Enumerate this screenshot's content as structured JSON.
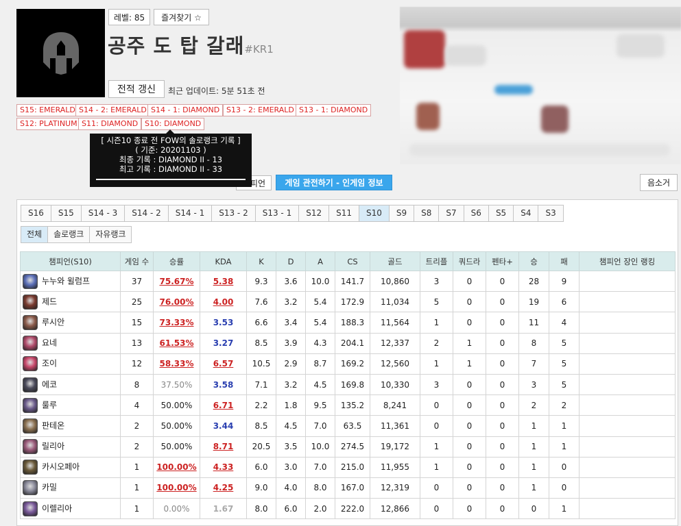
{
  "profile": {
    "level": "레벨: 85",
    "favorite": "즐겨찾기 ☆",
    "name": "공주 도 탑 갈래",
    "tag": "#KR1",
    "refresh": "전적 갱신",
    "last_update": "최근 업데이트: 5분 51초 전"
  },
  "badges": [
    "S15: EMERALD",
    "S14 - 2: EMERALD",
    "S14 - 1: DIAMOND",
    "S13 - 2: EMERALD",
    "S13 - 1: DIAMOND",
    "S12: PLATINUM",
    "S11: DIAMOND",
    "S10: DIAMOND"
  ],
  "tooltip": {
    "line1": "[ 시즌10 종료 전 FOW의 솔로랭크 기록 ]",
    "line2": "( 기준: 20201103 )",
    "line3": "최종 기록 : DIAMOND II - 13",
    "line4": "최고 기록 : DIAMOND II - 33"
  },
  "actions": {
    "champion": "피언",
    "spectate": "게임 관전하기 - 인게임 정보",
    "mute": "음소거"
  },
  "season_tabs": [
    "S16",
    "S15",
    "S14 - 3",
    "S14 - 2",
    "S14 - 1",
    "S13 - 2",
    "S13 - 1",
    "S12",
    "S11",
    "S10",
    "S9",
    "S8",
    "S7",
    "S6",
    "S5",
    "S4",
    "S3"
  ],
  "active_season": "S10",
  "queue_tabs": [
    "전체",
    "솔로랭크",
    "자유랭크"
  ],
  "active_queue": "전체",
  "table": {
    "headers": [
      "챔피언(S10)",
      "게임 수",
      "승률",
      "KDA",
      "K",
      "D",
      "A",
      "CS",
      "골드",
      "트리플",
      "쿼드라",
      "펜타+",
      "승",
      "패",
      "챔피언 장인 랭킹"
    ],
    "rows": [
      {
        "champ": "누누와 윌럼프",
        "games": "37",
        "wr": "75.67%",
        "wr_cls": "wr-hi",
        "kda": "5.38",
        "kda_cls": "kda-hi",
        "k": "9.3",
        "d": "3.6",
        "a": "10.0",
        "cs": "141.7",
        "gold": "10,860",
        "triple": "3",
        "quadra": "0",
        "penta": "0",
        "win": "28",
        "loss": "9",
        "color": "#5b6fb8"
      },
      {
        "champ": "제드",
        "games": "25",
        "wr": "76.00%",
        "wr_cls": "wr-hi",
        "kda": "4.00",
        "kda_cls": "kda-hi",
        "k": "7.6",
        "d": "3.2",
        "a": "5.4",
        "cs": "172.9",
        "gold": "11,034",
        "triple": "5",
        "quadra": "0",
        "penta": "0",
        "win": "19",
        "loss": "6",
        "color": "#7a3b30"
      },
      {
        "champ": "루시안",
        "games": "15",
        "wr": "73.33%",
        "wr_cls": "wr-hi",
        "kda": "3.53",
        "kda_cls": "kda-mid",
        "k": "6.6",
        "d": "3.4",
        "a": "5.4",
        "cs": "188.3",
        "gold": "11,564",
        "triple": "1",
        "quadra": "0",
        "penta": "0",
        "win": "11",
        "loss": "4",
        "color": "#8a5a4a"
      },
      {
        "champ": "요네",
        "games": "13",
        "wr": "61.53%",
        "wr_cls": "wr-hi",
        "kda": "3.27",
        "kda_cls": "kda-mid",
        "k": "8.5",
        "d": "3.9",
        "a": "4.3",
        "cs": "204.1",
        "gold": "12,337",
        "triple": "2",
        "quadra": "1",
        "penta": "0",
        "win": "8",
        "loss": "5",
        "color": "#b04a6a"
      },
      {
        "champ": "조이",
        "games": "12",
        "wr": "58.33%",
        "wr_cls": "wr-hi",
        "kda": "6.57",
        "kda_cls": "kda-hi",
        "k": "10.5",
        "d": "2.9",
        "a": "8.7",
        "cs": "169.2",
        "gold": "12,560",
        "triple": "1",
        "quadra": "1",
        "penta": "0",
        "win": "7",
        "loss": "5",
        "color": "#c8476a"
      },
      {
        "champ": "에코",
        "games": "8",
        "wr": "37.50%",
        "wr_cls": "wr-lo",
        "kda": "3.58",
        "kda_cls": "kda-mid",
        "k": "7.1",
        "d": "3.2",
        "a": "4.5",
        "cs": "169.8",
        "gold": "10,330",
        "triple": "3",
        "quadra": "0",
        "penta": "0",
        "win": "3",
        "loss": "5",
        "color": "#4a4a5a"
      },
      {
        "champ": "룰루",
        "games": "4",
        "wr": "50.00%",
        "wr_cls": "wr-mid",
        "kda": "6.71",
        "kda_cls": "kda-hi",
        "k": "2.2",
        "d": "1.8",
        "a": "9.5",
        "cs": "135.2",
        "gold": "8,241",
        "triple": "0",
        "quadra": "0",
        "penta": "0",
        "win": "2",
        "loss": "2",
        "color": "#6a5a8a"
      },
      {
        "champ": "판테온",
        "games": "2",
        "wr": "50.00%",
        "wr_cls": "wr-mid",
        "kda": "3.44",
        "kda_cls": "kda-mid",
        "k": "8.5",
        "d": "4.5",
        "a": "7.0",
        "cs": "63.5",
        "gold": "11,361",
        "triple": "0",
        "quadra": "0",
        "penta": "0",
        "win": "1",
        "loss": "1",
        "color": "#8a7050"
      },
      {
        "champ": "릴리아",
        "games": "2",
        "wr": "50.00%",
        "wr_cls": "wr-mid",
        "kda": "8.71",
        "kda_cls": "kda-hi",
        "k": "20.5",
        "d": "3.5",
        "a": "10.0",
        "cs": "274.5",
        "gold": "19,172",
        "triple": "1",
        "quadra": "0",
        "penta": "0",
        "win": "1",
        "loss": "1",
        "color": "#9a5a7a"
      },
      {
        "champ": "카시오페아",
        "games": "1",
        "wr": "100.00%",
        "wr_cls": "wr-hi",
        "kda": "4.33",
        "kda_cls": "kda-hi",
        "k": "6.0",
        "d": "3.0",
        "a": "7.0",
        "cs": "215.0",
        "gold": "11,955",
        "triple": "1",
        "quadra": "0",
        "penta": "0",
        "win": "1",
        "loss": "0",
        "color": "#6a5a3a"
      },
      {
        "champ": "카밀",
        "games": "1",
        "wr": "100.00%",
        "wr_cls": "wr-hi",
        "kda": "4.25",
        "kda_cls": "kda-hi",
        "k": "9.0",
        "d": "4.0",
        "a": "8.0",
        "cs": "167.0",
        "gold": "12,319",
        "triple": "0",
        "quadra": "0",
        "penta": "0",
        "win": "1",
        "loss": "0",
        "color": "#8a8a9a"
      },
      {
        "champ": "이렐리아",
        "games": "1",
        "wr": "0.00%",
        "wr_cls": "wr-lo",
        "kda": "1.67",
        "kda_cls": "kda-lo",
        "k": "8.0",
        "d": "6.0",
        "a": "2.0",
        "cs": "222.0",
        "gold": "12,866",
        "triple": "0",
        "quadra": "0",
        "penta": "0",
        "win": "0",
        "loss": "1",
        "color": "#7a5a9a"
      }
    ]
  }
}
